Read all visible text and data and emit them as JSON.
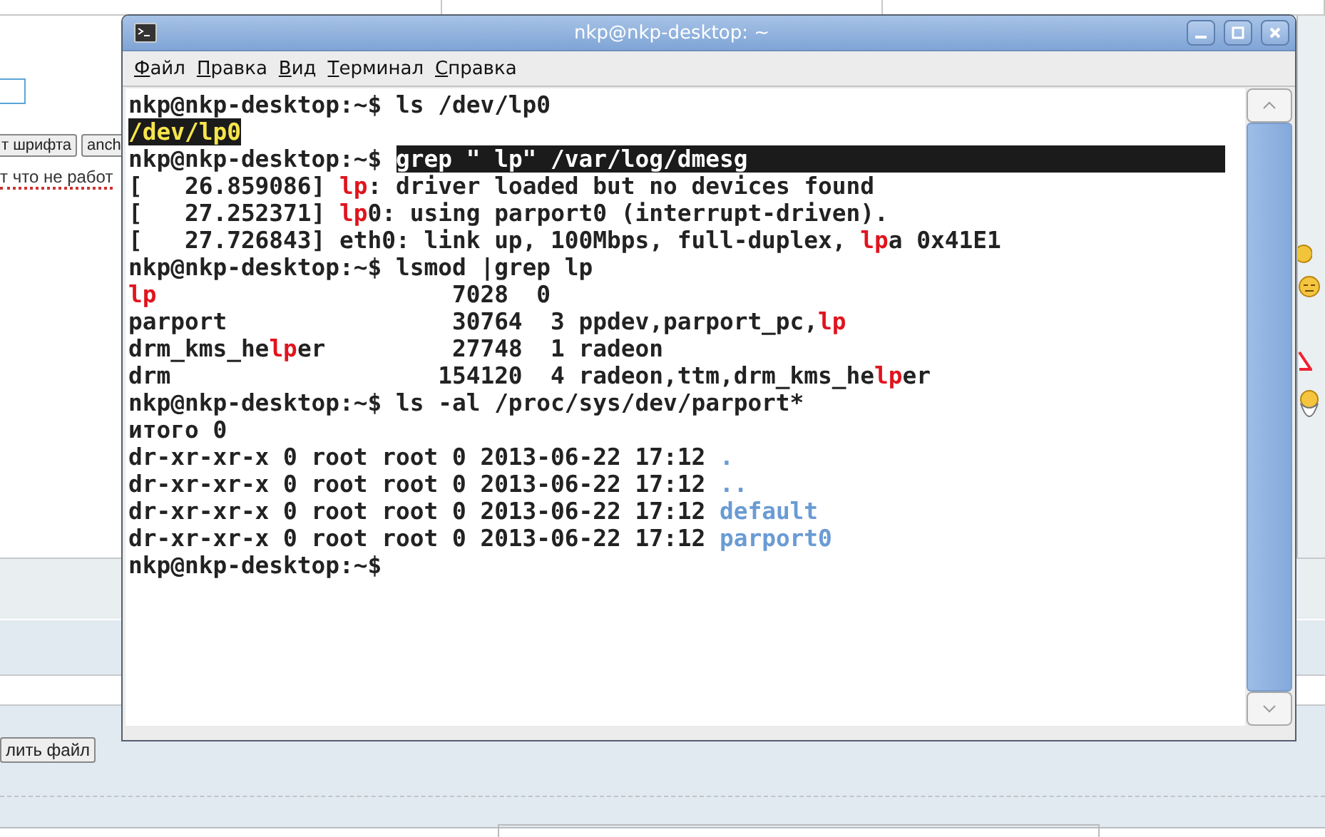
{
  "background": {
    "format_buttons": [
      "т шрифта",
      "anch"
    ],
    "note": "т что не работ",
    "file_button": "лить файл"
  },
  "window": {
    "title": "nkp@nkp-desktop: ~"
  },
  "menu": [
    "Файл",
    "Правка",
    "Вид",
    "Терминал",
    "Справка"
  ],
  "terminal": {
    "lines": [
      [
        {
          "kind": "plain",
          "text": "nkp@nkp-desktop:~$ ls /dev/lp0"
        }
      ],
      [
        {
          "kind": "highlight",
          "text": "/dev/lp0"
        }
      ],
      [
        {
          "kind": "plain",
          "text": "nkp@nkp-desktop:~$ "
        },
        {
          "kind": "selection",
          "text": "grep \" lp\" /var/log/dmesg"
        }
      ],
      [
        {
          "kind": "plain",
          "text": "[   26.859086] "
        },
        {
          "kind": "match",
          "text": "lp"
        },
        {
          "kind": "plain",
          "text": ": driver loaded but no devices found"
        }
      ],
      [
        {
          "kind": "plain",
          "text": "[   27.252371] "
        },
        {
          "kind": "match",
          "text": "lp"
        },
        {
          "kind": "plain",
          "text": "0: using parport0 (interrupt-driven)."
        }
      ],
      [
        {
          "kind": "plain",
          "text": "[   27.726843] eth0: link up, 100Mbps, full-duplex, "
        },
        {
          "kind": "match",
          "text": "lp"
        },
        {
          "kind": "plain",
          "text": "a 0x41E1"
        }
      ],
      [
        {
          "kind": "plain",
          "text": "nkp@nkp-desktop:~$ lsmod |grep lp"
        }
      ],
      [
        {
          "kind": "match",
          "text": "lp"
        },
        {
          "kind": "plain",
          "text": "                     7028  0"
        }
      ],
      [
        {
          "kind": "plain",
          "text": "parport                30764  3 ppdev,parport_pc,"
        },
        {
          "kind": "match",
          "text": "lp"
        }
      ],
      [
        {
          "kind": "plain",
          "text": "drm_kms_he"
        },
        {
          "kind": "match",
          "text": "lp"
        },
        {
          "kind": "plain",
          "text": "er         27748  1 radeon"
        }
      ],
      [
        {
          "kind": "plain",
          "text": "drm                   154120  4 radeon,ttm,drm_kms_he"
        },
        {
          "kind": "match",
          "text": "lp"
        },
        {
          "kind": "plain",
          "text": "er"
        }
      ],
      [
        {
          "kind": "plain",
          "text": "nkp@nkp-desktop:~$ ls -al /proc/sys/dev/parport*"
        }
      ],
      [
        {
          "kind": "plain",
          "text": "итого 0"
        }
      ],
      [
        {
          "kind": "plain",
          "text": "dr-xr-xr-x 0 root root 0 2013-06-22 17:12 "
        },
        {
          "kind": "dir",
          "text": "."
        }
      ],
      [
        {
          "kind": "plain",
          "text": "dr-xr-xr-x 0 root root 0 2013-06-22 17:12 "
        },
        {
          "kind": "dir",
          "text": ".."
        }
      ],
      [
        {
          "kind": "plain",
          "text": "dr-xr-xr-x 0 root root 0 2013-06-22 17:12 "
        },
        {
          "kind": "dir",
          "text": "default"
        }
      ],
      [
        {
          "kind": "plain",
          "text": "dr-xr-xr-x 0 root root 0 2013-06-22 17:12 "
        },
        {
          "kind": "dir",
          "text": "parport0"
        }
      ],
      [
        {
          "kind": "plain",
          "text": "nkp@nkp-desktop:~$"
        }
      ]
    ]
  }
}
